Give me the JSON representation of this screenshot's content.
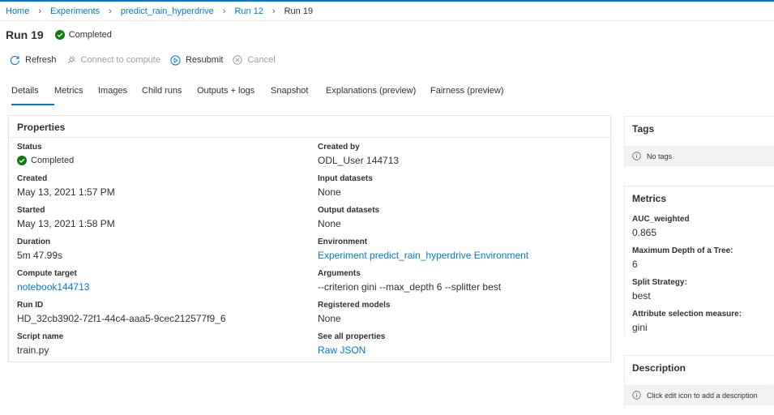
{
  "breadcrumb": {
    "items": [
      "Home",
      "Experiments",
      "predict_rain_hyperdrive",
      "Run 12"
    ],
    "current": "Run 19"
  },
  "header": {
    "title": "Run 19",
    "status": "Completed"
  },
  "toolbar": {
    "refresh": "Refresh",
    "connect": "Connect to compute",
    "resubmit": "Resubmit",
    "cancel": "Cancel"
  },
  "tabs": [
    "Details",
    "Metrics",
    "Images",
    "Child runs",
    "Outputs + logs",
    "Snapshot",
    "Explanations (preview)",
    "Fairness (preview)"
  ],
  "active_tab": "Details",
  "properties": {
    "title": "Properties",
    "left": [
      {
        "label": "Status",
        "value": "Completed"
      },
      {
        "label": "Created",
        "value": "May 13, 2021 1:57 PM"
      },
      {
        "label": "Started",
        "value": "May 13, 2021 1:58 PM"
      },
      {
        "label": "Duration",
        "value": "5m 47.99s"
      },
      {
        "label": "Compute target",
        "value": "notebook144713"
      },
      {
        "label": "Run ID",
        "value": "HD_32cb3902-72f1-44c4-aaa5-9cec212577f9_6"
      },
      {
        "label": "Script name",
        "value": "train.py"
      }
    ],
    "right": [
      {
        "label": "Created by",
        "value": "ODL_User 144713"
      },
      {
        "label": "Input datasets",
        "value": "None"
      },
      {
        "label": "Output datasets",
        "value": "None"
      },
      {
        "label": "Environment",
        "value": "Experiment predict_rain_hyperdrive Environment"
      },
      {
        "label": "Arguments",
        "value": "--criterion gini --max_depth 6 --splitter best"
      },
      {
        "label": "Registered models",
        "value": "None"
      },
      {
        "label": "See all properties",
        "value": "Raw JSON"
      }
    ]
  },
  "tags": {
    "title": "Tags",
    "empty": "No tags"
  },
  "metrics": {
    "title": "Metrics",
    "items": [
      {
        "label": "AUC_weighted",
        "value": "0.865"
      },
      {
        "label": "Maximum Depth of a Tree:",
        "value": "6"
      },
      {
        "label": "Split Strategy:",
        "value": "best"
      },
      {
        "label": "Attribute selection measure:",
        "value": "gini"
      }
    ]
  },
  "description": {
    "title": "Description",
    "hint": "Click edit icon to add a description"
  },
  "colors": {
    "accent": "#0078d4",
    "success": "#107c10",
    "text": "#323130",
    "disabled": "#a19f9d"
  }
}
